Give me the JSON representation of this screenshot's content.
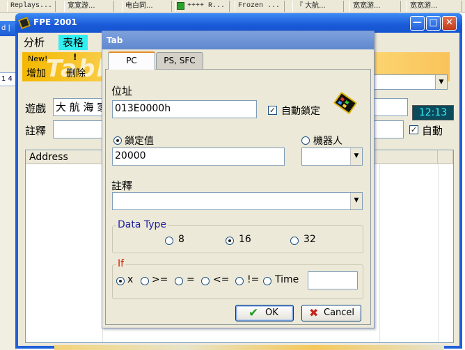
{
  "taskbar": [
    "Replays...",
    "宽宽游...",
    "电白同...",
    "++++ R...",
    "Frozen ...",
    "『 大航...",
    "宽宽游...",
    "宽宽游..."
  ],
  "stub": {
    "text1": "d |",
    "text2": "1 4"
  },
  "main": {
    "title": "FPE 2001",
    "buttons": {
      "minimize": "—",
      "maximize": "□",
      "close": "✕"
    },
    "tab_analysis": "分析",
    "tab_table": "表格",
    "new_label": "New!",
    "add_button": "增加",
    "delete_button": "删除",
    "banner_word": "Table",
    "game_label": "遊戲",
    "game_value": "大 航 海 家",
    "time": "12:13",
    "note_label": "註釋",
    "auto_label": "自動",
    "auto_checked": true,
    "list_header_address": "Address"
  },
  "dialog": {
    "title": "Tab",
    "tabs": [
      "PC",
      "PS, SFC"
    ],
    "address_label": "位址",
    "address_value": "013E0000h",
    "auto_lock_label": "自動鎖定",
    "auto_lock_checked": true,
    "lock_value_label": "鎖定值",
    "lock_value": "20000",
    "robot_label": "機器人",
    "note_label": "註釋",
    "note_value": "",
    "data_type_title": "Data Type",
    "data_types": [
      "8",
      "16",
      "32"
    ],
    "data_type_selected": "16",
    "if_title": "If",
    "if_options": [
      "x",
      ">=",
      "=",
      "<=",
      "!=",
      "Time"
    ],
    "if_selected": "x",
    "time_value": "",
    "ok_label": "OK",
    "cancel_label": "Cancel",
    "colors": {
      "accent": "#1654cf",
      "tab_highlight": "#e68b2c",
      "group_title": "#2020a0",
      "if_title": "#d02000"
    }
  }
}
